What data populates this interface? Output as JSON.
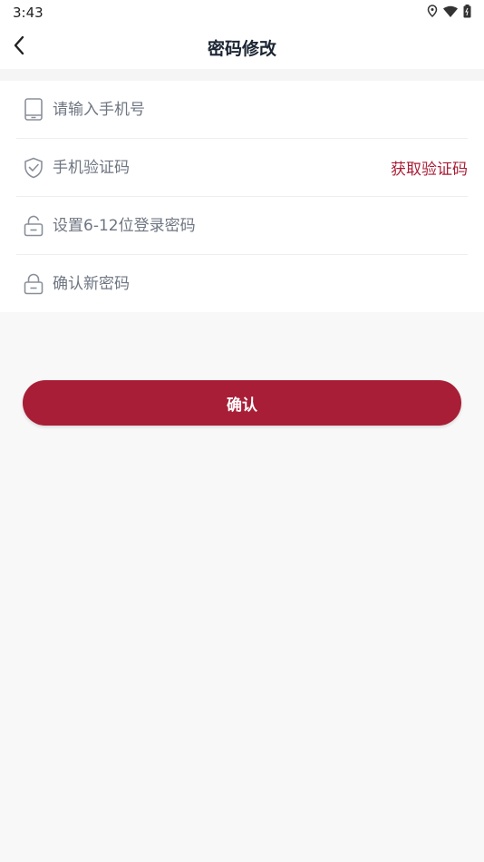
{
  "status_bar": {
    "time": "3:43"
  },
  "nav": {
    "title": "密码修改"
  },
  "form": {
    "phone_placeholder": "请输入手机号",
    "code_placeholder": "手机验证码",
    "get_code_label": "获取验证码",
    "new_password_placeholder": "设置6-12位登录密码",
    "confirm_password_placeholder": "确认新密码"
  },
  "actions": {
    "confirm_label": "确认"
  },
  "colors": {
    "accent": "#a81e36",
    "background": "#f8f8f8"
  }
}
